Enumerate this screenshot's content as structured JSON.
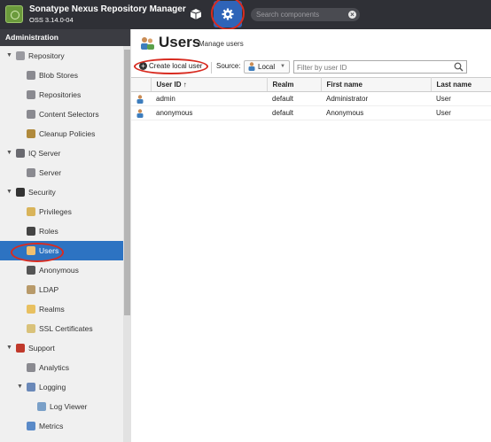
{
  "app": {
    "title": "Sonatype Nexus Repository Manager",
    "version": "OSS 3.14.0-04",
    "search_placeholder": "Search components",
    "browse_icon": "cube-icon",
    "admin_icon": "gear-icon"
  },
  "sidebar": {
    "header": "Administration",
    "items": [
      {
        "label": "Repository",
        "level": 0,
        "expanded": true,
        "icon": "database-icon"
      },
      {
        "label": "Blob Stores",
        "level": 1,
        "icon": "blobstore-icon"
      },
      {
        "label": "Repositories",
        "level": 1,
        "icon": "repositories-icon"
      },
      {
        "label": "Content Selectors",
        "level": 1,
        "icon": "selector-icon"
      },
      {
        "label": "Cleanup Policies",
        "level": 1,
        "icon": "broom-icon"
      },
      {
        "label": "IQ Server",
        "level": 0,
        "expanded": true,
        "icon": "iq-icon"
      },
      {
        "label": "Server",
        "level": 1,
        "icon": "server-icon"
      },
      {
        "label": "Security",
        "level": 0,
        "expanded": true,
        "icon": "eye-icon"
      },
      {
        "label": "Privileges",
        "level": 1,
        "icon": "privileges-icon"
      },
      {
        "label": "Roles",
        "level": 1,
        "icon": "roles-icon"
      },
      {
        "label": "Users",
        "level": 1,
        "icon": "users-icon",
        "selected": true
      },
      {
        "label": "Anonymous",
        "level": 1,
        "icon": "anonymous-icon"
      },
      {
        "label": "LDAP",
        "level": 1,
        "icon": "ldap-icon"
      },
      {
        "label": "Realms",
        "level": 1,
        "icon": "realms-icon"
      },
      {
        "label": "SSL Certificates",
        "level": 1,
        "icon": "certificate-icon"
      },
      {
        "label": "Support",
        "level": 0,
        "expanded": true,
        "icon": "support-icon"
      },
      {
        "label": "Analytics",
        "level": 1,
        "icon": "analytics-icon"
      },
      {
        "label": "Logging",
        "level": 1,
        "expanded": true,
        "icon": "logging-icon"
      },
      {
        "label": "Log Viewer",
        "level": 2,
        "icon": "logviewer-icon"
      },
      {
        "label": "Metrics",
        "level": 1,
        "icon": "metrics-icon"
      }
    ]
  },
  "main": {
    "title": "Users",
    "subtitle": "Manage users",
    "toolbar": {
      "create_label": "Create local user",
      "source_label": "Source:",
      "source_value": "Local",
      "filter_placeholder": "Filter by user ID"
    },
    "table": {
      "columns": [
        "User ID ↑",
        "Realm",
        "First name",
        "Last name"
      ],
      "rows": [
        [
          "admin",
          "default",
          "Administrator",
          "User"
        ],
        [
          "anonymous",
          "default",
          "Anonymous",
          "User"
        ]
      ]
    }
  }
}
